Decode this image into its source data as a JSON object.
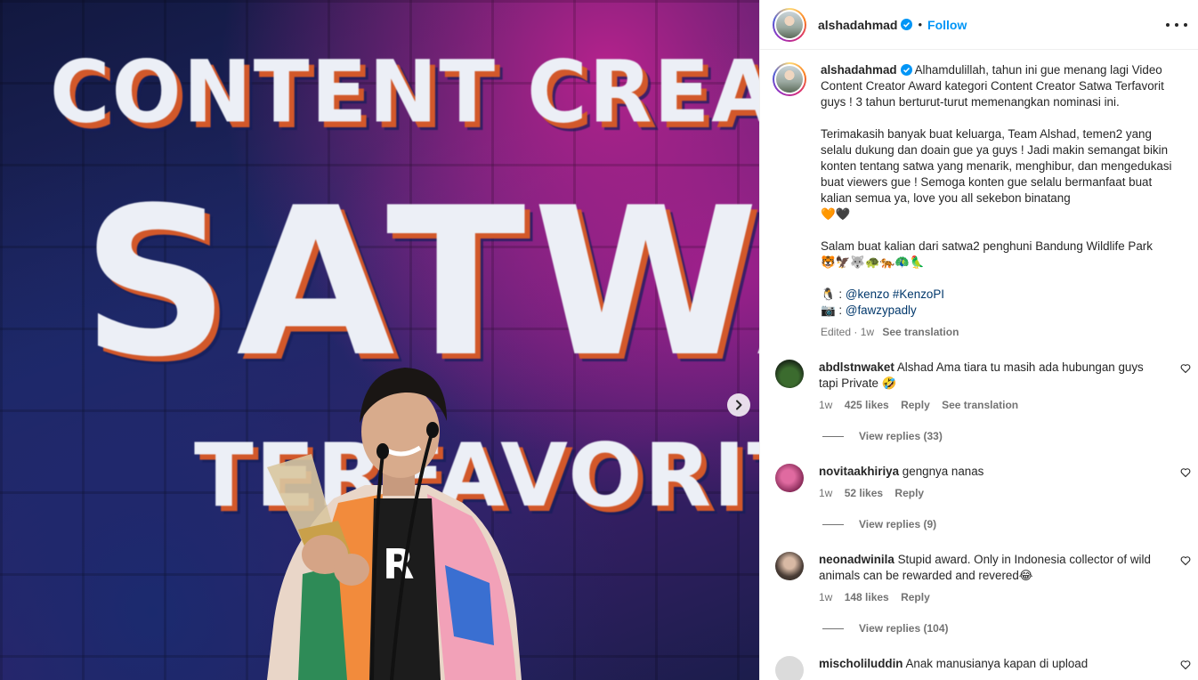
{
  "post_image": {
    "line1": "CONTENT CREATOR",
    "line2": "SATWA",
    "line3": "TERFAVORIT"
  },
  "header": {
    "username": "alshadahmad",
    "separator": "•",
    "follow_label": "Follow"
  },
  "caption": {
    "username": "alshadahmad",
    "para1": "Alhamdulillah, tahun ini gue menang lagi Video Content Creator Award kategori Content Creator Satwa Terfavorit guys ! 3 tahun berturut-turut memenangkan nominasi ini.",
    "para2": "Terimakasih banyak buat keluarga, Team Alshad, temen2 yang selalu dukung dan doain gue ya guys ! Jadi makin semangat bikin konten tentang satwa yang menarik, menghibur, dan mengedukasi buat viewers gue ! Semoga konten gue selalu bermanfaat buat kalian semua ya, love you all sekebon binatang",
    "hearts": "🧡🖤",
    "para3": "Salam buat kalian dari satwa2 penghuni Bandung Wildlife Park",
    "animals": "🐯🦅🐺🐢🐅🦚🦜",
    "credit1_icon": "🐧",
    "credit1_sep": " : ",
    "credit1_user": "@kenzo",
    "credit1_tag": "#KenzoPI",
    "credit2_icon": "📷",
    "credit2_sep": " : ",
    "credit2_user": "@fawzypadly",
    "edited": "Edited · 1w",
    "see_translation": "See translation"
  },
  "comments": [
    {
      "username": "abdlstnwaket",
      "text": "Alshad Ama tiara tu masih ada hubungan guys tapi Private 🤣",
      "time": "1w",
      "likes": "425 likes",
      "reply": "Reply",
      "translation": "See translation",
      "view_replies": "View replies (33)"
    },
    {
      "username": "novitaakhiriya",
      "text": "gengnya nanas",
      "time": "1w",
      "likes": "52 likes",
      "reply": "Reply",
      "view_replies": "View replies (9)"
    },
    {
      "username": "neonadwinila",
      "text": "Stupid award. Only in Indonesia collector of wild animals can be rewarded and revered😂",
      "time": "1w",
      "likes": "148 likes",
      "reply": "Reply",
      "view_replies": "View replies (104)"
    },
    {
      "username": "mischoliluddin",
      "text": "Anak manusianya kapan di upload"
    }
  ],
  "colors": {
    "follow": "#0095f6",
    "verified": "#0095f6",
    "link": "#00376b",
    "secondary_text": "#737373"
  },
  "icons": [
    "chevron-right-icon",
    "more-horizontal-icon",
    "verified-badge-icon",
    "heart-outline-icon"
  ]
}
